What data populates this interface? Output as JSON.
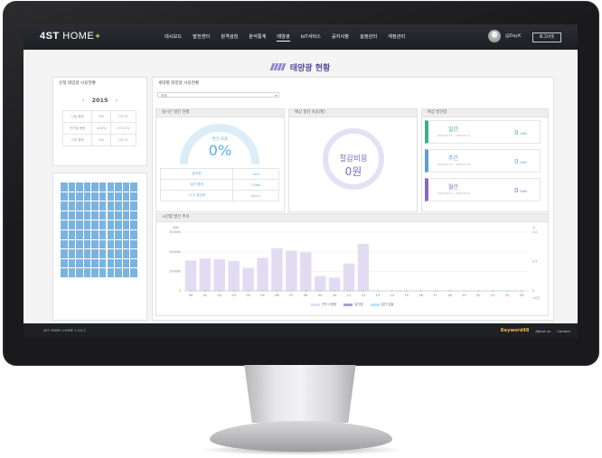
{
  "nav": {
    "logo_main": "4ST",
    "logo_sub": "HOME",
    "menu": [
      "대시보드",
      "발전센터",
      "원격검침",
      "분석통계",
      "태양광",
      "IoT서비스",
      "공지사항",
      "설정관리",
      "계정관리"
    ],
    "user": "@DayK",
    "logout": "로그아웃"
  },
  "page_title": "태양광 현황",
  "annual": {
    "title": "유형 태양광 사용현황",
    "year": "2015",
    "rows": [
      [
        "시설 용량",
        "0%",
        "0/172"
      ],
      [
        "가구별 용량",
        "100%",
        "172/172"
      ],
      [
        "고장 용량",
        "0%",
        "0/172"
      ]
    ],
    "panel_count": 100
  },
  "household": {
    "title": "세대별 태양광 사용현황",
    "select_value": "전체"
  },
  "realtime": {
    "title": "실시간 발전 현황",
    "gauge_label": "발전 효율",
    "gauge_value": "0%",
    "rows": [
      [
        "발전량",
        "0wh"
      ],
      [
        "발전 용량",
        "20Wa"
      ],
      [
        "CO2 절감량",
        "0kcc2"
      ]
    ]
  },
  "savings": {
    "title": "예상 절감 비용(월)",
    "label": "절감비용",
    "value": "0원"
  },
  "generation": {
    "title": "예상 발전량",
    "items": [
      {
        "label": "일간",
        "dates": "2016.05.11 ~ 2016.05.11",
        "value": "0",
        "unit": "kWh",
        "color": "#3fae8b"
      },
      {
        "label": "주간",
        "dates": "2016.05.11 ~ 2016.05.18",
        "value": "0",
        "unit": "kWh",
        "color": "#5b9fd8"
      },
      {
        "label": "월간",
        "dates": "2016.05.01 ~ 2016.06.01",
        "value": "0",
        "unit": "kWh",
        "color": "#8a66c9"
      }
    ]
  },
  "hourly": {
    "title": "시간별 발전 추이"
  },
  "chart_data": {
    "type": "bar",
    "title": "시간별 발전 추이",
    "xlabel": "",
    "ylabel": "kWh",
    "categories": [
      "00",
      "01",
      "02",
      "03",
      "04",
      "05",
      "06",
      "07",
      "08",
      "09",
      "10",
      "11",
      "12",
      "13",
      "14",
      "15",
      "16",
      "17",
      "18",
      "19",
      "20",
      "21",
      "22",
      "23"
    ],
    "series": [
      {
        "name": "전력 사용량",
        "values": [
          15500,
          16500,
          16200,
          15200,
          11800,
          16800,
          21800,
          20500,
          19800,
          7500,
          6800,
          14000,
          24000,
          0,
          0,
          0,
          0,
          0,
          0,
          0,
          0,
          0,
          0,
          0
        ]
      },
      {
        "name": "발전량",
        "values": [
          0,
          0,
          0,
          0,
          0,
          0,
          0,
          0,
          0,
          0,
          0,
          0,
          0,
          0,
          0,
          0,
          0,
          0,
          0,
          0,
          0,
          0,
          0,
          0
        ]
      },
      {
        "name": "발전 효율",
        "values": [
          0,
          0,
          0,
          0,
          0,
          0,
          0,
          0,
          0,
          0,
          0,
          0,
          0,
          0,
          0,
          0,
          0,
          0,
          0,
          0,
          0,
          0,
          0,
          0
        ]
      }
    ],
    "ylim": [
      0,
      30000
    ],
    "y_ticks": [
      "0",
      "10000k",
      "20000k",
      "30000k"
    ],
    "y2_ticks": [
      "0",
      "0.5",
      "1.0"
    ],
    "y_unit": "kWh",
    "y2_unit": "%",
    "x_unit": "(시간)",
    "colors": {
      "usage": "#e2dcf3",
      "gen": "#a99dd4",
      "eff": "#bde3f5"
    }
  },
  "footer": {
    "copyright": "4ST HOME I HOME 1.0.0.2",
    "brand": "Keyword48",
    "links": [
      "About us",
      "Contact"
    ]
  }
}
